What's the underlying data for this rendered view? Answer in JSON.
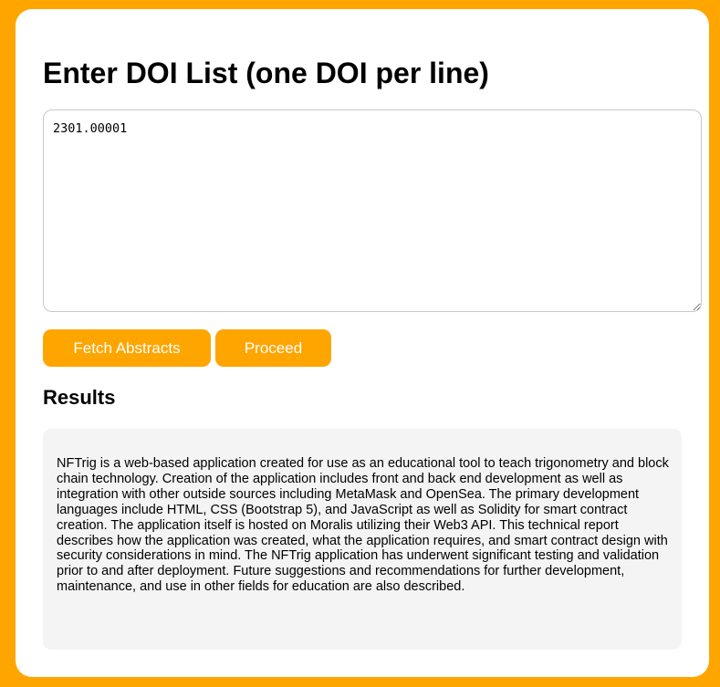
{
  "colors": {
    "accent": "#FFA500",
    "card_background": "#FFFFFF",
    "results_background": "#F4F4F4"
  },
  "page": {
    "title": "Enter DOI List (one DOI per line)"
  },
  "doi_input": {
    "value": "2301.00001"
  },
  "buttons": {
    "fetch_label": "Fetch Abstracts",
    "proceed_label": "Proceed"
  },
  "results": {
    "heading": "Results",
    "abstracts": [
      "NFTrig is a web-based application created for use as an educational tool to teach trigonometry and block chain technology. Creation of the application includes front and back end development as well as integration with other outside sources including MetaMask and OpenSea. The primary development languages include HTML, CSS (Bootstrap 5), and JavaScript as well as Solidity for smart contract creation. The application itself is hosted on Moralis utilizing their Web3 API. This technical report describes how the application was created, what the application requires, and smart contract design with security considerations in mind. The NFTrig application has underwent significant testing and validation prior to and after deployment. Future suggestions and recommendations for further development, maintenance, and use in other fields for education are also described."
    ]
  }
}
